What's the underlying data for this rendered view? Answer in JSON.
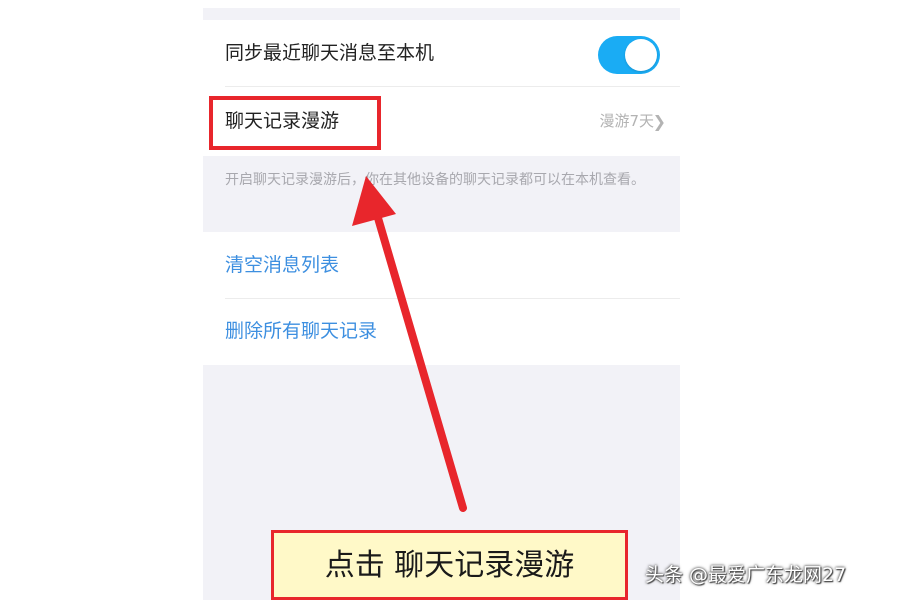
{
  "settings": {
    "sync_label": "同步最近聊天消息至本机",
    "sync_enabled": true,
    "roaming_label": "聊天记录漫游",
    "roaming_value": "漫游7天",
    "roaming_footnote": "开启聊天记录漫游后，你在其他设备的聊天记录都可以在本机查看。",
    "clear_list_label": "清空消息列表",
    "delete_all_label": "删除所有聊天记录"
  },
  "annotation": {
    "caption": "点击 聊天记录漫游",
    "highlight_color": "#e8262c",
    "caption_background": "#fff9c8"
  },
  "watermark": {
    "text": "头条 @最爱广东龙网27"
  },
  "colors": {
    "toggle_on": "#1aacf4",
    "link_blue": "#3d8fe0",
    "background_gray": "#f2f2f7"
  }
}
